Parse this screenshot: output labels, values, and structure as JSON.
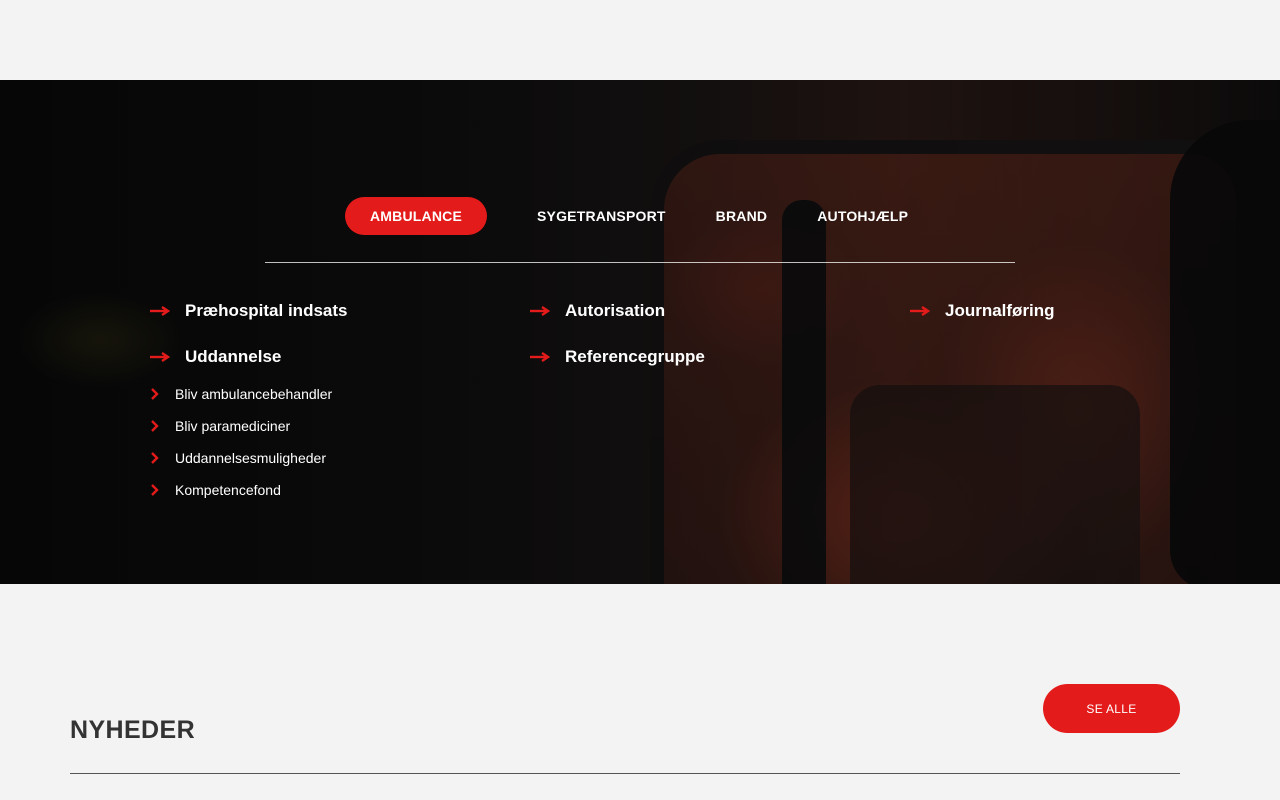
{
  "tabs": [
    {
      "label": "AMBULANCE",
      "active": true
    },
    {
      "label": "SYGETRANSPORT",
      "active": false
    },
    {
      "label": "BRAND",
      "active": false
    },
    {
      "label": "AUTOHJÆLP",
      "active": false
    }
  ],
  "columns": {
    "c1": {
      "links": [
        "Præhospital indsats",
        "Uddannelse"
      ],
      "sub_links": [
        "Bliv ambulancebehandler",
        "Bliv paramediciner",
        "Uddannelsesmuligheder",
        "Kompetencefond"
      ]
    },
    "c2": {
      "links": [
        "Autorisation",
        "Referencegruppe"
      ]
    },
    "c3": {
      "links": [
        "Journalføring"
      ]
    }
  },
  "news": {
    "title": "NYHEDER",
    "see_all_label": "SE ALLE"
  },
  "colors": {
    "accent": "#e41b1b",
    "page_bg": "#f3f3f3",
    "text_dark": "#333333"
  },
  "icons": {
    "link_arrow": "arrow-right-icon",
    "sub_link": "chevron-right-icon"
  }
}
